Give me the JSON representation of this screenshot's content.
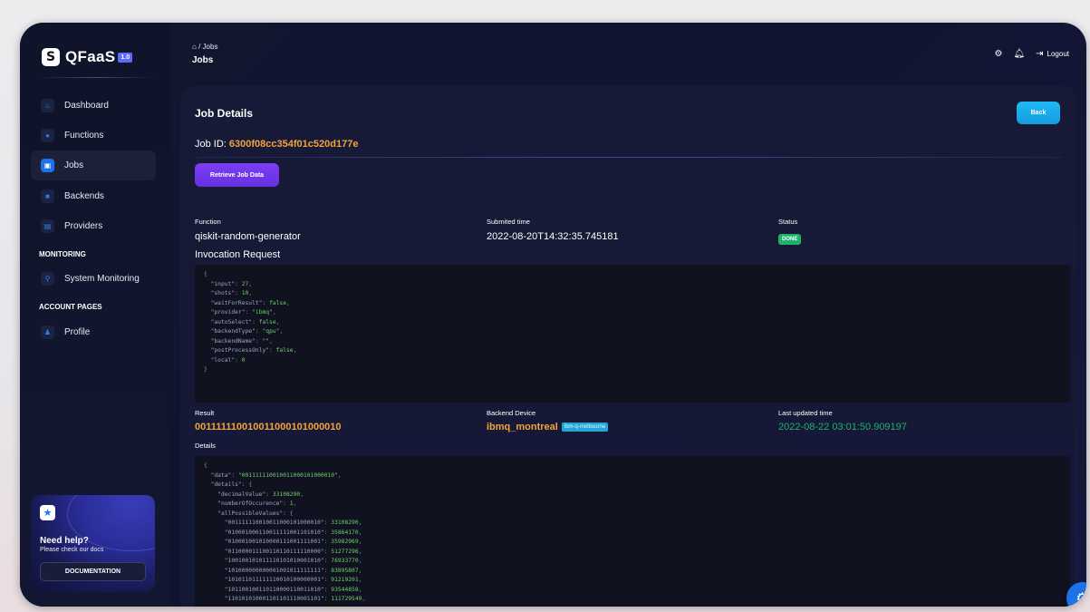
{
  "app": {
    "name": "QFaaS",
    "version": "1.0"
  },
  "sidebar": {
    "items": [
      {
        "label": "Dashboard",
        "icon": "home-icon"
      },
      {
        "label": "Functions",
        "icon": "functions-icon"
      },
      {
        "label": "Jobs",
        "icon": "jobs-icon",
        "active": true
      },
      {
        "label": "Backends",
        "icon": "backends-icon"
      },
      {
        "label": "Providers",
        "icon": "providers-icon"
      }
    ],
    "monitoring_title": "MONITORING",
    "monitoring_item": "System Monitoring",
    "account_title": "ACCOUNT PAGES",
    "account_item": "Profile",
    "help": {
      "title": "Need help?",
      "subtitle": "Please check our docs",
      "button": "DOCUMENTATION"
    }
  },
  "header": {
    "breadcrumb_sep": "/",
    "breadcrumb_current": "Jobs",
    "title": "Jobs",
    "logout_label": "Logout"
  },
  "card": {
    "title": "Job Details",
    "back_label": "Back",
    "job_id_label": "Job ID:",
    "job_id": "6300f08cc354f01c520d177e",
    "retrieve_label": "Retrieve Job Data",
    "function_label": "Function",
    "function_value": "qiskit-random-generator",
    "submitted_label": "Submited time",
    "submitted_value": "2022-08-20T14:32:35.745181",
    "status_label": "Status",
    "status_value": "DONE",
    "invocation_label": "Invocation Request",
    "invocation_lines": [
      {
        "t": "{",
        "cls": "p"
      },
      {
        "t": "  \"input\": 27,",
        "cls": "kv"
      },
      {
        "t": "  \"shots\": 10,",
        "cls": "kv"
      },
      {
        "t": "  \"waitForResult\": false,",
        "cls": "kv"
      },
      {
        "t": "  \"provider\": \"ibmq\",",
        "cls": "kv"
      },
      {
        "t": "  \"autoSelect\": false,",
        "cls": "kv"
      },
      {
        "t": "  \"backendType\": \"qpu\",",
        "cls": "kv"
      },
      {
        "t": "  \"backendName\": \"\",",
        "cls": "kv"
      },
      {
        "t": "  \"postProcessOnly\": false,",
        "cls": "kv"
      },
      {
        "t": "  \"local\": 0",
        "cls": "kv"
      },
      {
        "t": "}",
        "cls": "p"
      }
    ],
    "result_label": "Result",
    "result_value": "001111110010011000101000010",
    "device_label": "Backend Device",
    "device_value": "ibmq_montreal",
    "device_tag": "ibm-q-melbourne",
    "updated_label": "Last updated time",
    "updated_value": "2022-08-22 03:01:50.909197",
    "details_label": "Details",
    "details_lines": [
      {
        "t": "{",
        "cls": "p"
      },
      {
        "t": "  \"data\": \"001111110010011000101000010\",",
        "cls": "kv"
      },
      {
        "t": "  \"details\": {",
        "cls": "kv"
      },
      {
        "t": "    \"decimalValue\": 33108290,",
        "cls": "kv"
      },
      {
        "t": "    \"numberOfOccurence\": 1,",
        "cls": "kv"
      },
      {
        "t": "    \"allPossibleValues\": {",
        "cls": "kv"
      },
      {
        "t": "      \"001111110010011000101000010\": 33108290,",
        "cls": "kv"
      },
      {
        "t": "      \"010001000110011111001101010\": 35864170,",
        "cls": "kv"
      },
      {
        "t": "      \"010001001010000111001111001\": 35982969,",
        "cls": "kv"
      },
      {
        "t": "      \"011000011100110110111110000\": 51277296,",
        "cls": "kv"
      },
      {
        "t": "      \"100100101011110101010001010\": 76933770,",
        "cls": "kv"
      },
      {
        "t": "      \"101000000000001001011111111\": 83895807,",
        "cls": "kv"
      },
      {
        "t": "      \"101011011111110010100000001\": 91219201,",
        "cls": "kv"
      },
      {
        "t": "      \"101100100110110000110011010\": 93544858,",
        "cls": "kv"
      },
      {
        "t": "      \"110101010001101101110001101\": 111729549,",
        "cls": "kv"
      }
    ]
  },
  "colors": {
    "accent_blue": "#1a73e8",
    "accent_orange": "#f3a43c",
    "success_green": "#1fb16a",
    "purple_button": "#7b3ff5",
    "back_button": "#20b8f5"
  }
}
